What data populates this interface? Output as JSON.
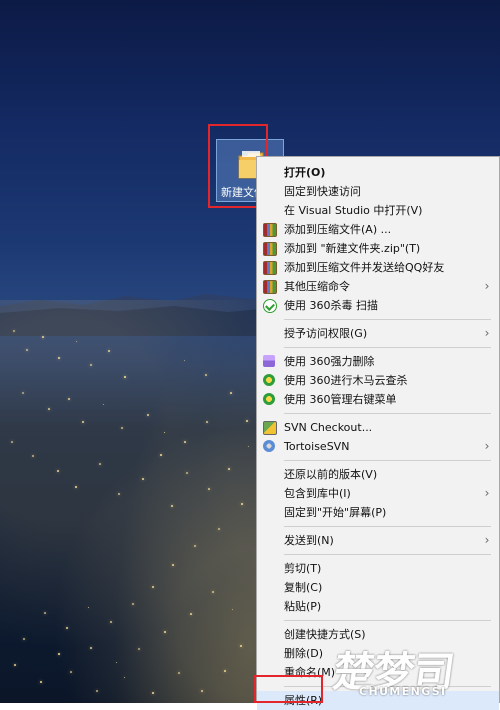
{
  "desktop": {
    "folder_label": "新建文件夹"
  },
  "menu": {
    "items": [
      {
        "label": "打开(O)",
        "icon": "",
        "submenu": false,
        "strong": true,
        "selected": false
      },
      {
        "label": "固定到快速访问",
        "icon": "",
        "submenu": false,
        "strong": false,
        "selected": false
      },
      {
        "label": "在 Visual Studio 中打开(V)",
        "icon": "",
        "submenu": false,
        "strong": false,
        "selected": false
      },
      {
        "label": "添加到压缩文件(A) ...",
        "icon": "archive-icon",
        "submenu": false,
        "strong": false,
        "selected": false
      },
      {
        "label": "添加到 \"新建文件夹.zip\"(T)",
        "icon": "archive-icon",
        "submenu": false,
        "strong": false,
        "selected": false
      },
      {
        "label": "添加到压缩文件并发送给QQ好友",
        "icon": "archive-icon",
        "submenu": false,
        "strong": false,
        "selected": false
      },
      {
        "label": "其他压缩命令",
        "icon": "archive-icon",
        "submenu": true,
        "strong": false,
        "selected": false
      },
      {
        "label": "使用 360杀毒 扫描",
        "icon": "shield-icon",
        "submenu": false,
        "strong": false,
        "selected": false
      },
      {
        "separator": true
      },
      {
        "label": "授予访问权限(G)",
        "icon": "",
        "submenu": true,
        "strong": false,
        "selected": false
      },
      {
        "separator": true
      },
      {
        "label": "使用 360强力删除",
        "icon": "purple-tool-icon",
        "submenu": false,
        "strong": false,
        "selected": false
      },
      {
        "label": "使用 360进行木马云查杀",
        "icon": "security-360-icon",
        "submenu": false,
        "strong": false,
        "selected": false
      },
      {
        "label": "使用 360管理右键菜单",
        "icon": "security-360-icon",
        "submenu": false,
        "strong": false,
        "selected": false
      },
      {
        "separator": true
      },
      {
        "label": "SVN Checkout...",
        "icon": "svn-icon",
        "submenu": false,
        "strong": false,
        "selected": false
      },
      {
        "label": "TortoiseSVN",
        "icon": "tortoise-icon",
        "submenu": true,
        "strong": false,
        "selected": false
      },
      {
        "separator": true
      },
      {
        "label": "还原以前的版本(V)",
        "icon": "",
        "submenu": false,
        "strong": false,
        "selected": false
      },
      {
        "label": "包含到库中(I)",
        "icon": "",
        "submenu": true,
        "strong": false,
        "selected": false
      },
      {
        "label": "固定到\"开始\"屏幕(P)",
        "icon": "",
        "submenu": false,
        "strong": false,
        "selected": false
      },
      {
        "separator": true
      },
      {
        "label": "发送到(N)",
        "icon": "",
        "submenu": true,
        "strong": false,
        "selected": false
      },
      {
        "separator": true
      },
      {
        "label": "剪切(T)",
        "icon": "",
        "submenu": false,
        "strong": false,
        "selected": false
      },
      {
        "label": "复制(C)",
        "icon": "",
        "submenu": false,
        "strong": false,
        "selected": false
      },
      {
        "label": "粘贴(P)",
        "icon": "",
        "submenu": false,
        "strong": false,
        "selected": false
      },
      {
        "separator": true
      },
      {
        "label": "创建快捷方式(S)",
        "icon": "",
        "submenu": false,
        "strong": false,
        "selected": false
      },
      {
        "label": "删除(D)",
        "icon": "",
        "submenu": false,
        "strong": false,
        "selected": false
      },
      {
        "label": "重命名(M)",
        "icon": "",
        "submenu": false,
        "strong": false,
        "selected": false
      },
      {
        "separator": true
      },
      {
        "label": "属性(R)",
        "icon": "",
        "submenu": false,
        "strong": false,
        "selected": true
      }
    ]
  },
  "watermark": {
    "main_text": "楚梦司",
    "sub_text": "CHUMENGSI"
  }
}
